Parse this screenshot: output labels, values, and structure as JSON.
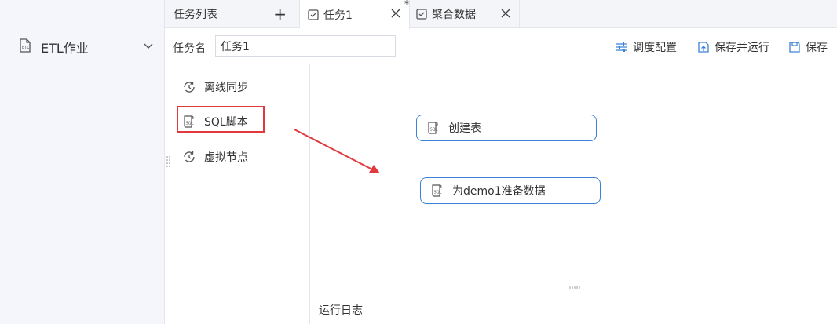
{
  "sidebar": {
    "item_label": "ETL作业"
  },
  "tabs": [
    {
      "label": "任务列表"
    },
    {
      "label": "任务1",
      "modified_mark": "*"
    },
    {
      "label": "聚合数据"
    }
  ],
  "toolbar": {
    "task_name_label": "任务名",
    "task_name_value": "任务1",
    "schedule_label": "调度配置",
    "save_run_label": "保存并运行",
    "save_label": "保存"
  },
  "palette": {
    "items": [
      {
        "label": "离线同步",
        "icon": "sync-icon"
      },
      {
        "label": "SQL脚本",
        "icon": "sql-script-icon"
      },
      {
        "label": "虚拟节点",
        "icon": "sync-icon"
      }
    ]
  },
  "canvas": {
    "nodes": [
      {
        "label": "创建表",
        "icon": "sql-script-icon"
      },
      {
        "label": "为demo1准备数据",
        "icon": "sql-script-icon"
      }
    ]
  },
  "log": {
    "title": "运行日志"
  },
  "colors": {
    "accent": "#3b82d6",
    "highlight": "#e0393e",
    "sidebar_bg": "#f4f6fb"
  }
}
